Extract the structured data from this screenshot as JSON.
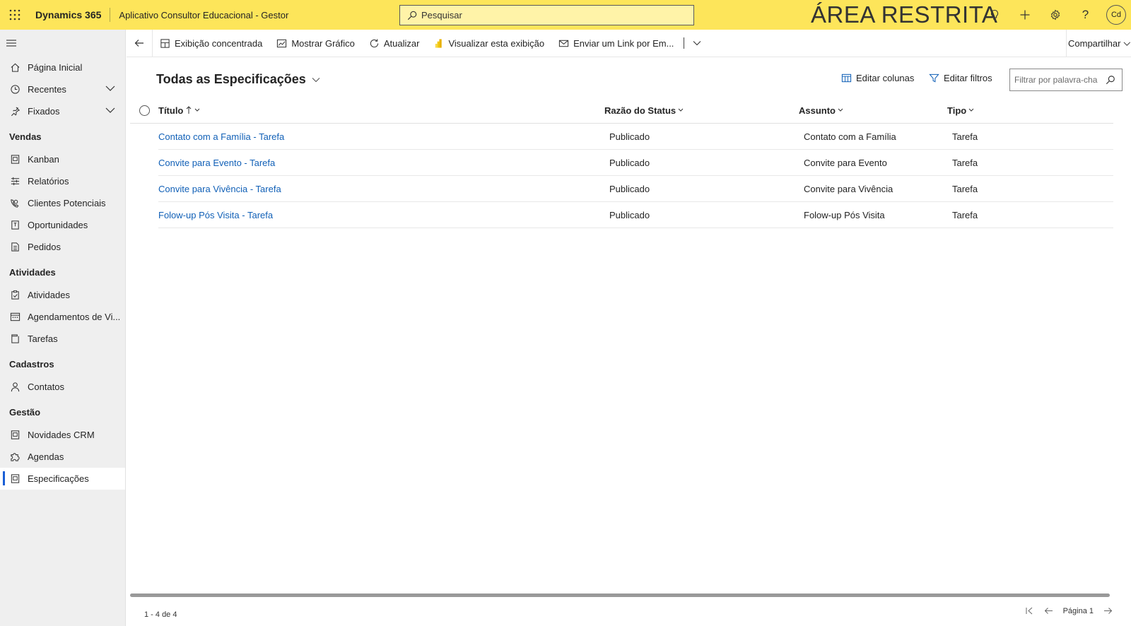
{
  "topbar": {
    "brand": "Dynamics 365",
    "app_name": "Aplicativo Consultor Educacional - Gestor",
    "search_placeholder": "Pesquisar",
    "banner": "ÁREA RESTRITA",
    "avatar_initials": "Cd",
    "accent_color": "#fde55a"
  },
  "sidebar": {
    "items_top": [
      {
        "label": "Página Inicial",
        "icon": "home-icon"
      },
      {
        "label": "Recentes",
        "icon": "clock-icon"
      },
      {
        "label": "Fixados",
        "icon": "pin-icon"
      }
    ],
    "groups": [
      {
        "title": "Vendas",
        "items": [
          {
            "label": "Kanban",
            "icon": "entity-icon"
          },
          {
            "label": "Relatórios",
            "icon": "report-icon"
          },
          {
            "label": "Clientes Potenciais",
            "icon": "phone-person-icon"
          },
          {
            "label": "Oportunidades",
            "icon": "document-icon"
          },
          {
            "label": "Pedidos",
            "icon": "order-icon"
          }
        ]
      },
      {
        "title": "Atividades",
        "items": [
          {
            "label": "Atividades",
            "icon": "clipboard-icon"
          },
          {
            "label": "Agendamentos de Vi...",
            "icon": "calendar-icon"
          },
          {
            "label": "Tarefas",
            "icon": "task-icon"
          }
        ]
      },
      {
        "title": "Cadastros",
        "items": [
          {
            "label": "Contatos",
            "icon": "person-icon"
          }
        ]
      },
      {
        "title": "Gestão",
        "items": [
          {
            "label": "Novidades CRM",
            "icon": "entity-icon"
          },
          {
            "label": "Agendas",
            "icon": "puzzle-icon"
          },
          {
            "label": "Especificações",
            "icon": "entity-icon",
            "active": true
          }
        ]
      }
    ]
  },
  "commandbar": {
    "focused_view": "Exibição concentrada",
    "show_chart": "Mostrar Gráfico",
    "refresh": "Atualizar",
    "visualize": "Visualizar esta exibição",
    "email_link": "Enviar um Link por Em...",
    "share": "Compartilhar"
  },
  "view": {
    "title": "Todas as Especificações",
    "edit_columns": "Editar colunas",
    "edit_filters": "Editar filtros",
    "filter_placeholder": "Filtrar por palavra-cha",
    "columns": [
      "Título",
      "Razão do Status",
      "Assunto",
      "Tipo"
    ],
    "rows": [
      {
        "titulo": "Contato com a Família - Tarefa",
        "status": "Publicado",
        "assunto": "Contato com a Família",
        "tipo": "Tarefa"
      },
      {
        "titulo": "Convite para Evento - Tarefa",
        "status": "Publicado",
        "assunto": "Convite para Evento",
        "tipo": "Tarefa"
      },
      {
        "titulo": "Convite para Vivência - Tarefa",
        "status": "Publicado",
        "assunto": "Convite para Vivência",
        "tipo": "Tarefa"
      },
      {
        "titulo": "Folow-up Pós Visita - Tarefa",
        "status": "Publicado",
        "assunto": "Folow-up Pós Visita",
        "tipo": "Tarefa"
      }
    ],
    "record_count": "1 - 4 de 4",
    "page_label": "Página 1"
  }
}
